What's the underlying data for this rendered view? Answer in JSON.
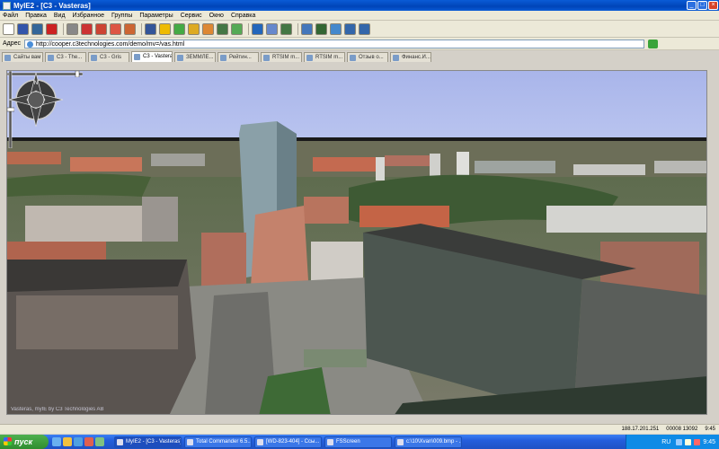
{
  "window": {
    "title": "MyIE2 - [C3 - Vasteras]"
  },
  "menu": [
    "Файл",
    "Правка",
    "Вид",
    "Избранное",
    "Группы",
    "Параметры",
    "Сервис",
    "Окно",
    "Справка"
  ],
  "toolbar": {
    "icons": [
      {
        "name": "new-window-icon",
        "color": "#ffffff"
      },
      {
        "name": "save-icon",
        "color": "#3355aa"
      },
      {
        "name": "save-all-icon",
        "color": "#336699"
      },
      {
        "name": "close-tab-icon",
        "color": "#cc2222"
      },
      {
        "name": "back-icon",
        "color": "#888888"
      },
      {
        "name": "stop-icon",
        "color": "#cc3333"
      },
      {
        "name": "refresh-icon",
        "color": "#cc4433"
      },
      {
        "name": "refresh-all-icon",
        "color": "#dd5544"
      },
      {
        "name": "home-icon",
        "color": "#cc6633"
      },
      {
        "name": "search-icon",
        "color": "#335599"
      },
      {
        "name": "favorites-star-icon",
        "color": "#eebb00"
      },
      {
        "name": "groups-icon",
        "color": "#44aa44"
      },
      {
        "name": "history-icon",
        "color": "#ddaa22"
      },
      {
        "name": "collector-icon",
        "color": "#dd8833"
      },
      {
        "name": "proxy-icon",
        "color": "#447744"
      },
      {
        "name": "web-filter-icon",
        "color": "#55aa55"
      },
      {
        "name": "globe-icon",
        "color": "#2266bb"
      },
      {
        "name": "mail-icon",
        "color": "#6688cc"
      },
      {
        "name": "text-size-icon",
        "color": "#447744"
      },
      {
        "name": "fullscreen-icon",
        "color": "#4477bb"
      },
      {
        "name": "popup-filter-icon",
        "color": "#336633"
      },
      {
        "name": "auto-refresh-icon",
        "color": "#4488cc"
      },
      {
        "name": "window-layout-icon",
        "color": "#3366aa"
      },
      {
        "name": "tile-icon",
        "color": "#3366aa"
      }
    ]
  },
  "address": {
    "label": "Адрес",
    "url": "http://cooper.c3technologies.com/demo/mv=/vas.html"
  },
  "tabs": [
    {
      "label": "Сайты вам",
      "active": false
    },
    {
      "label": "C3 - The...",
      "active": false
    },
    {
      "label": "C3 - Gris",
      "active": false
    },
    {
      "label": "C3 - Vasteras",
      "active": true
    },
    {
      "label": "ЗЕММЛЕ...",
      "active": false
    },
    {
      "label": "Рейтин...",
      "active": false
    },
    {
      "label": "RTSIM m...",
      "active": false
    },
    {
      "label": "RTSIM m...",
      "active": false
    },
    {
      "label": "Отзыв о...",
      "active": false
    },
    {
      "label": "Финанс.И...",
      "active": false
    }
  ],
  "map": {
    "copyright": "Vasteras, myIE by C3 Technologies AB",
    "zoom_level": 0.95,
    "tilt_level": 0.5
  },
  "status": {
    "ip": "188.17.201.251",
    "zone": "00008 13092",
    "time": "9:45"
  },
  "taskbar": {
    "start_label": "пуск",
    "tasks": [
      {
        "label": "MyIE2 - [C3 - Vasteras]",
        "active": true
      },
      {
        "label": "Total Commander 6.5...",
        "active": false
      },
      {
        "label": "[WD-823-404] - Ссы...",
        "active": false
      },
      {
        "label": "FSScreen",
        "active": false
      },
      {
        "label": "c:\\10\\Xvan\\009.bmp - ...",
        "active": false
      }
    ],
    "tray": {
      "lang": "RU",
      "time": "9:45"
    }
  }
}
